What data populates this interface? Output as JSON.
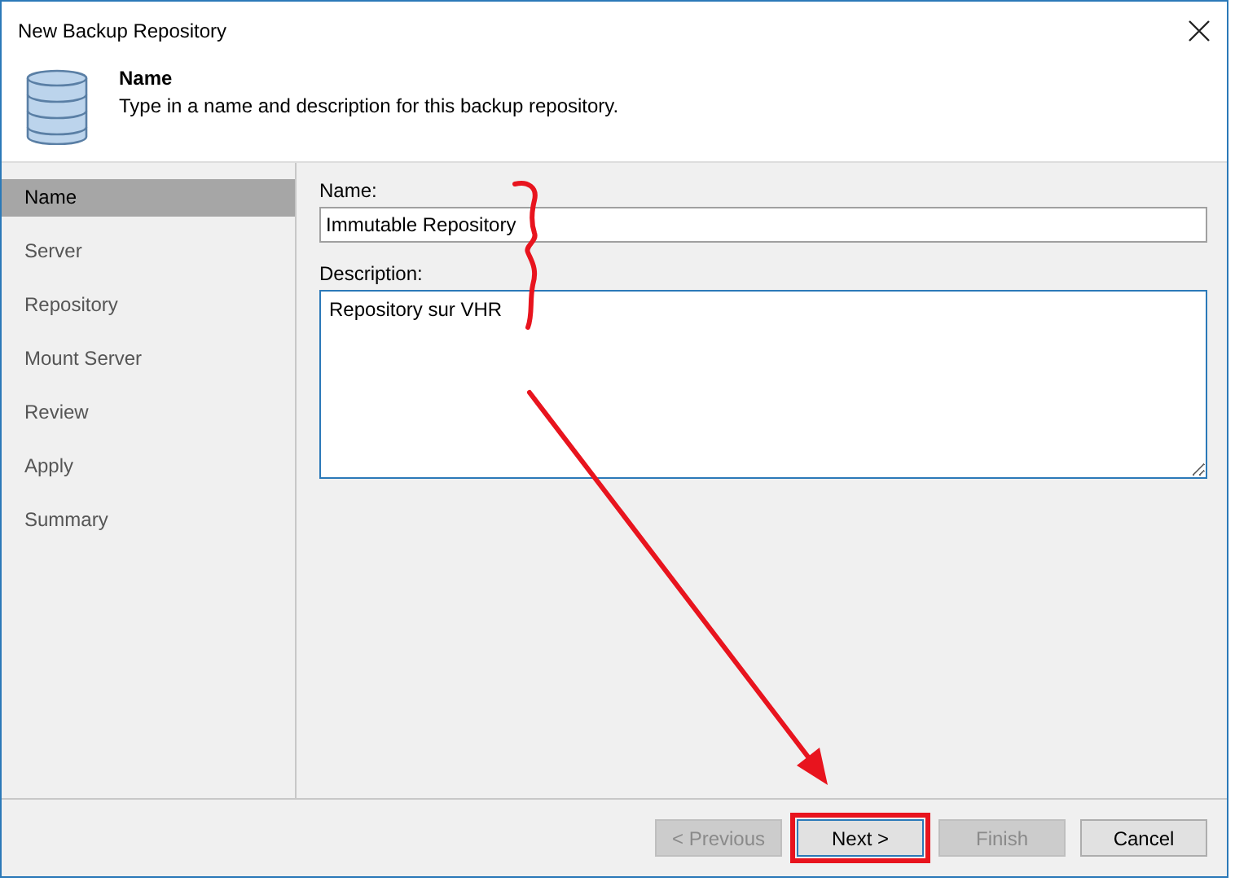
{
  "window": {
    "title": "New Backup Repository"
  },
  "header": {
    "title": "Name",
    "subtitle": "Type in a name and description for this backup repository."
  },
  "steps": [
    {
      "label": "Name",
      "selected": true
    },
    {
      "label": "Server",
      "selected": false
    },
    {
      "label": "Repository",
      "selected": false
    },
    {
      "label": "Mount Server",
      "selected": false
    },
    {
      "label": "Review",
      "selected": false
    },
    {
      "label": "Apply",
      "selected": false
    },
    {
      "label": "Summary",
      "selected": false
    }
  ],
  "name_field": {
    "label": "Name:",
    "value": "Immutable Repository"
  },
  "description_field": {
    "label": "Description:",
    "value": "Repository sur VHR"
  },
  "buttons": [
    {
      "label": "< Previous",
      "disabled": true,
      "annotated": false
    },
    {
      "label": "Next >",
      "disabled": false,
      "annotated": true
    },
    {
      "label": "Finish",
      "disabled": true,
      "annotated": false
    },
    {
      "label": "Cancel",
      "disabled": false,
      "annotated": false
    }
  ]
}
